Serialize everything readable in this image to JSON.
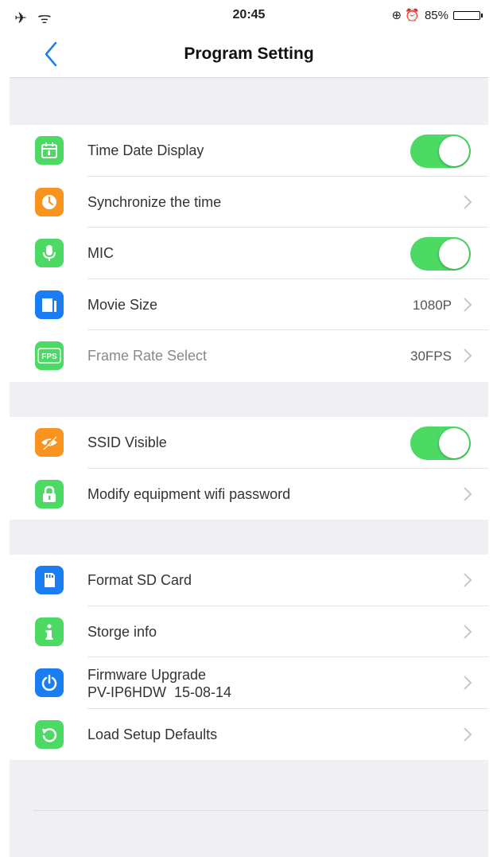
{
  "status_bar": {
    "left_icons": "✈ ᯤ",
    "time": "20:45",
    "right_icons": "⊕ ⏰",
    "battery": "85%",
    "battery_level": 0.85
  },
  "nav": {
    "title": "Program Setting"
  },
  "colors": {
    "green": "#4cd964",
    "orange": "#f7931e",
    "blue": "#1a7ef2",
    "toggle_on": "#4cd964"
  },
  "section1": {
    "items": [
      {
        "label": "Time Date Display",
        "icon": "calendar-icon",
        "control": "toggle",
        "on": true
      },
      {
        "label": "Synchronize the time",
        "icon": "clock-icon",
        "control": "chevron"
      },
      {
        "label": "MIC",
        "icon": "microphone-icon",
        "control": "toggle",
        "on": true
      },
      {
        "label": "Movie Size",
        "icon": "movie-size-icon",
        "control": "chevron",
        "value": "1080P"
      },
      {
        "label": "Frame Rate Select",
        "icon": "fps-icon",
        "control": "chevron",
        "value": "30FPS"
      }
    ]
  },
  "section2": {
    "items": [
      {
        "label": "SSID Visible",
        "icon": "eye-hidden-icon",
        "control": "toggle",
        "on": true
      },
      {
        "label": "Modify equipment wifi password",
        "icon": "lock-icon",
        "control": "chevron"
      }
    ]
  },
  "section3": {
    "items": [
      {
        "label": "Format SD Card",
        "icon": "sd-card-icon",
        "control": "chevron"
      },
      {
        "label": "Storge info",
        "icon": "info-icon",
        "control": "chevron"
      },
      {
        "label": "Firmware Upgrade",
        "sublabel": "PV-IP6HDW  15-08-14",
        "icon": "power-icon",
        "control": "chevron"
      },
      {
        "label": "Load Setup Defaults",
        "icon": "reset-icon",
        "control": "chevron"
      }
    ]
  }
}
